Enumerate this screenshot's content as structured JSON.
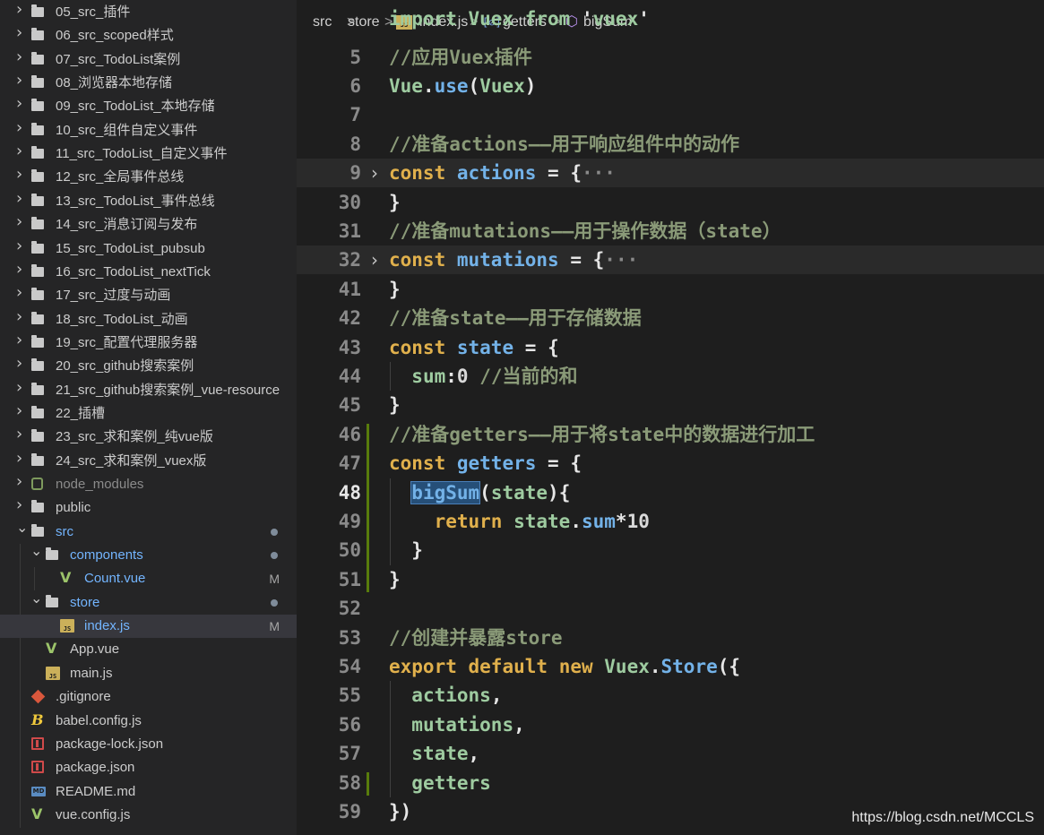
{
  "sidebar": {
    "items": [
      {
        "label": "05_src_插件",
        "type": "folder",
        "expanded": false
      },
      {
        "label": "06_src_scoped样式",
        "type": "folder",
        "expanded": false
      },
      {
        "label": "07_src_TodoList案例",
        "type": "folder",
        "expanded": false
      },
      {
        "label": "08_浏览器本地存储",
        "type": "folder",
        "expanded": false
      },
      {
        "label": "09_src_TodoList_本地存储",
        "type": "folder",
        "expanded": false
      },
      {
        "label": "10_src_组件自定义事件",
        "type": "folder",
        "expanded": false
      },
      {
        "label": "11_src_TodoList_自定义事件",
        "type": "folder",
        "expanded": false
      },
      {
        "label": "12_src_全局事件总线",
        "type": "folder",
        "expanded": false
      },
      {
        "label": "13_src_TodoList_事件总线",
        "type": "folder",
        "expanded": false
      },
      {
        "label": "14_src_消息订阅与发布",
        "type": "folder",
        "expanded": false
      },
      {
        "label": "15_src_TodoList_pubsub",
        "type": "folder",
        "expanded": false
      },
      {
        "label": "16_src_TodoList_nextTick",
        "type": "folder",
        "expanded": false
      },
      {
        "label": "17_src_过度与动画",
        "type": "folder",
        "expanded": false
      },
      {
        "label": "18_src_TodoList_动画",
        "type": "folder",
        "expanded": false
      },
      {
        "label": "19_src_配置代理服务器",
        "type": "folder",
        "expanded": false
      },
      {
        "label": "20_src_github搜索案例",
        "type": "folder",
        "expanded": false
      },
      {
        "label": "21_src_github搜索案例_vue-resource",
        "type": "folder",
        "expanded": false
      },
      {
        "label": "22_插槽",
        "type": "folder",
        "expanded": false
      },
      {
        "label": "23_src_求和案例_纯vue版",
        "type": "folder",
        "expanded": false
      },
      {
        "label": "24_src_求和案例_vuex版",
        "type": "folder",
        "expanded": false
      },
      {
        "label": "node_modules",
        "type": "node",
        "expanded": false
      },
      {
        "label": "public",
        "type": "folder",
        "expanded": false
      },
      {
        "label": "src",
        "type": "folder",
        "expanded": true
      },
      {
        "label": "components",
        "type": "folder",
        "expanded": true
      },
      {
        "label": "Count.vue",
        "type": "vue",
        "badge": "M"
      },
      {
        "label": "store",
        "type": "folder",
        "expanded": true
      },
      {
        "label": "index.js",
        "type": "js",
        "badge": "M"
      },
      {
        "label": "App.vue",
        "type": "vue"
      },
      {
        "label": "main.js",
        "type": "js"
      },
      {
        "label": ".gitignore",
        "type": "git"
      },
      {
        "label": "babel.config.js",
        "type": "babel"
      },
      {
        "label": "package-lock.json",
        "type": "json"
      },
      {
        "label": "package.json",
        "type": "json"
      },
      {
        "label": "README.md",
        "type": "md"
      },
      {
        "label": "vue.config.js",
        "type": "vue"
      }
    ]
  },
  "breadcrumb": {
    "parts": [
      "src",
      "store",
      "index.js",
      "getters",
      "bigSum"
    ],
    "js_icon_text": "JS",
    "var_icon_text": "[⊘]",
    "cube_icon_text": "⬡"
  },
  "editor": {
    "partial_top_line": "import Vuex from 'vuex'",
    "lines": [
      {
        "num": "5",
        "text": "//应用Vuex插件"
      },
      {
        "num": "6",
        "text": "Vue.use(Vuex)"
      },
      {
        "num": "7",
        "text": ""
      },
      {
        "num": "8",
        "text": "//准备actions——用于响应组件中的动作"
      },
      {
        "num": "9",
        "text": "const actions = {···"
      },
      {
        "num": "30",
        "text": "}"
      },
      {
        "num": "31",
        "text": "//准备mutations——用于操作数据（state）"
      },
      {
        "num": "32",
        "text": "const mutations = {···"
      },
      {
        "num": "41",
        "text": "}"
      },
      {
        "num": "42",
        "text": "//准备state——用于存储数据"
      },
      {
        "num": "43",
        "text": "const state = {"
      },
      {
        "num": "44",
        "text": "  sum:0 //当前的和"
      },
      {
        "num": "45",
        "text": "}"
      },
      {
        "num": "46",
        "text": "//准备getters——用于将state中的数据进行加工"
      },
      {
        "num": "47",
        "text": "const getters = {"
      },
      {
        "num": "48",
        "text": "  bigSum(state){"
      },
      {
        "num": "49",
        "text": "    return state.sum*10"
      },
      {
        "num": "50",
        "text": "  }"
      },
      {
        "num": "51",
        "text": "}"
      },
      {
        "num": "52",
        "text": ""
      },
      {
        "num": "53",
        "text": "//创建并暴露store"
      },
      {
        "num": "54",
        "text": "export default new Vuex.Store({"
      },
      {
        "num": "55",
        "text": "  actions,"
      },
      {
        "num": "56",
        "text": "  mutations,"
      },
      {
        "num": "57",
        "text": "  state,"
      },
      {
        "num": "58",
        "text": "  getters"
      },
      {
        "num": "59",
        "text": "})"
      }
    ]
  },
  "watermark": "https://blog.csdn.net/MCCLS"
}
